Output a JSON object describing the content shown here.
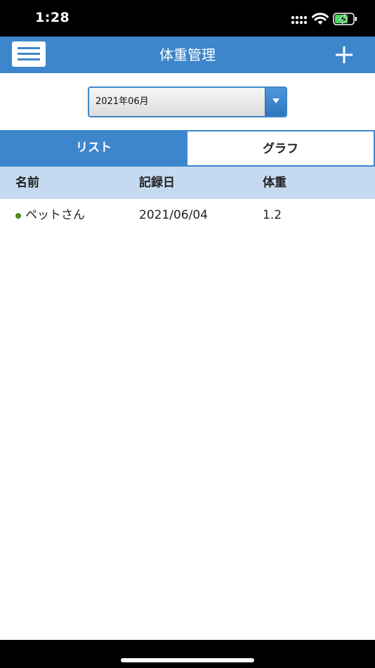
{
  "status_bar": {
    "time": "1:28",
    "icons": [
      "signal-icon",
      "wifi-icon",
      "battery-charging-icon"
    ]
  },
  "header": {
    "title": "体重管理",
    "menu_icon": "hamburger-menu-icon",
    "add_icon": "plus-icon"
  },
  "date_select": {
    "value": "2021年06月"
  },
  "tabs": [
    {
      "label": "リスト",
      "active": true
    },
    {
      "label": "グラフ",
      "active": false
    }
  ],
  "table": {
    "columns": [
      "名前",
      "記録日",
      "体重"
    ],
    "rows": [
      {
        "name": "ペットさん",
        "date": "2021/06/04",
        "weight": "1.2"
      }
    ]
  },
  "colors": {
    "accent": "#3d86cc",
    "header_row": "#c5daf0",
    "pet_dot": "#4a8a2a"
  }
}
